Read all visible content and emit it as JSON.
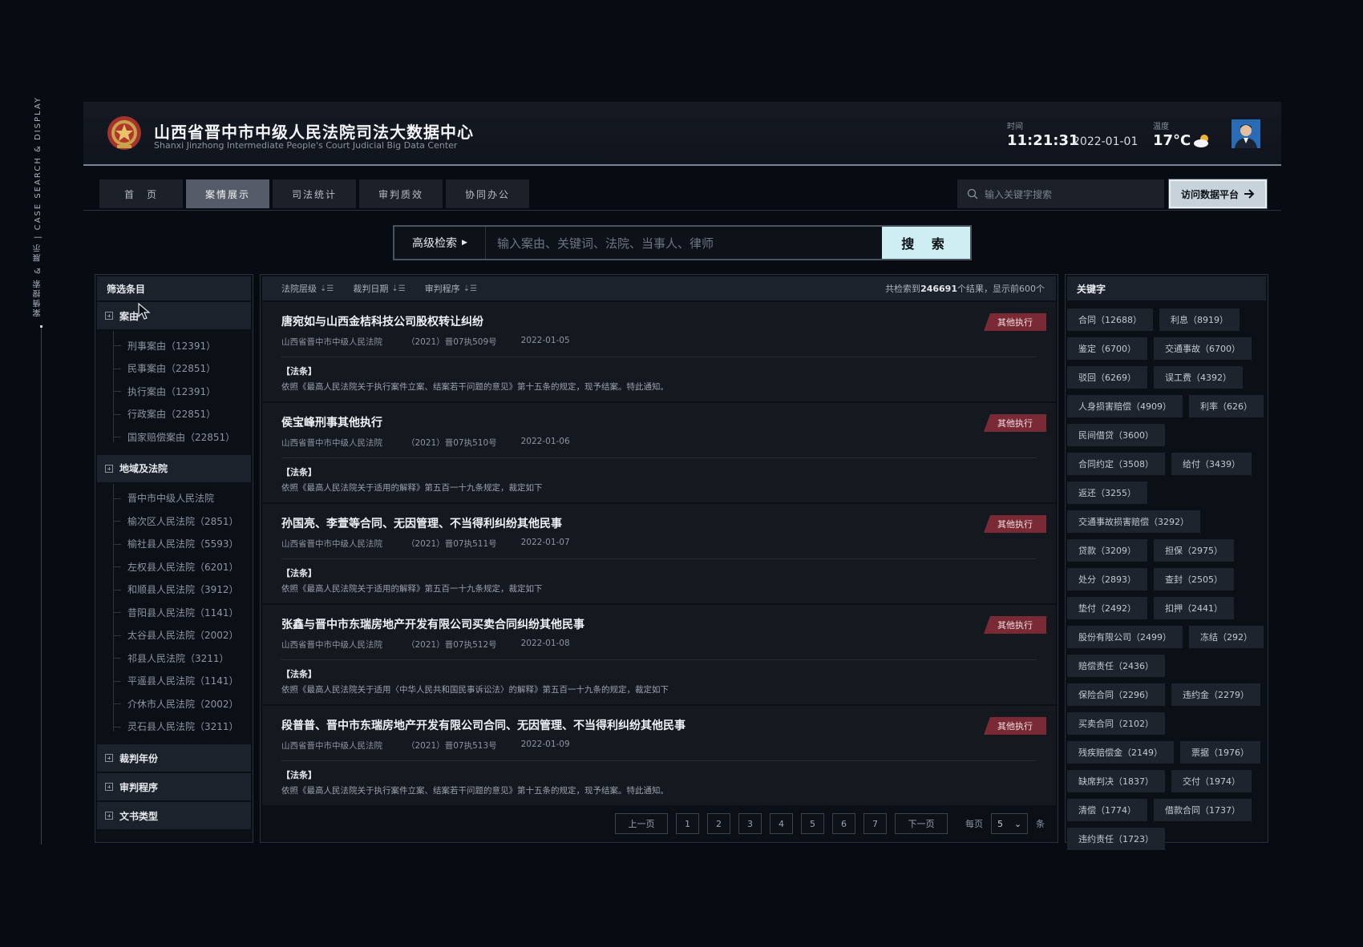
{
  "side_label": "案情搜索 & 展示 | CASE SEARCH & DISPLAY",
  "header": {
    "title_cn": "山西省晋中市中级人民法院司法大数据中心",
    "title_en": "Shanxi Jinzhong Intermediate People's Court Judicial Big Data Center",
    "time_label": "时间",
    "time": "11:21:31",
    "date": "2022-01-01",
    "temp_label": "温度",
    "temp": "17°C",
    "weather_icon": "partly-cloudy-icon"
  },
  "nav": {
    "tabs": [
      "首　页",
      "案情展示",
      "司法统计",
      "审判质效",
      "协同办公"
    ],
    "active_index": 1,
    "search_placeholder": "输入关键字搜索",
    "visit_button": "访问数据平台"
  },
  "main_search": {
    "advanced": "高级检索",
    "placeholder": "输入案由、关键词、法院、当事人、律师",
    "button": "搜 索"
  },
  "filters": {
    "title": "筛选条目",
    "groups": [
      {
        "label": "案由",
        "items": [
          "刑事案由（12391）",
          "民事案由（22851）",
          "执行案由（12391）",
          "行政案由（22851）",
          "国家赔偿案由（22851）"
        ]
      },
      {
        "label": "地域及法院",
        "items": [
          "晋中市中级人民法院",
          "榆次区人民法院（2851）",
          "榆社县人民法院（5593）",
          "左权县人民法院（6201）",
          "和顺县人民法院（3912）",
          "昔阳县人民法院（1141）",
          "太谷县人民法院（2002）",
          "祁县人民法院（3211）",
          "平遥县人民法院（1141）",
          "介休市人民法院（2002）",
          "灵石县人民法院（3211）"
        ]
      },
      {
        "label": "裁判年份",
        "items": []
      },
      {
        "label": "审判程序",
        "items": []
      },
      {
        "label": "文书类型",
        "items": []
      }
    ]
  },
  "list": {
    "sorts": [
      "法院层级",
      "裁判日期",
      "审判程序"
    ],
    "count_prefix": "共检索到",
    "count": "246691",
    "count_suffix": "个结果，显示前600个",
    "cases": [
      {
        "title": "唐宛如与山西金桔科技公司股权转让纠纷",
        "court": "山西省晋中市中级人民法院",
        "case_no": "（2021）晋07执509号",
        "date": "2022-01-05",
        "badge": "其他执行",
        "law_label": "【法条】",
        "law": "依照《最高人民法院关于执行案件立案、结案若干问题的意见》第十五条的规定，现予结案。特此通知。"
      },
      {
        "title": "侯宝峰刑事其他执行",
        "court": "山西省晋中市中级人民法院",
        "case_no": "（2021）晋07执510号",
        "date": "2022-01-06",
        "badge": "其他执行",
        "law_label": "【法条】",
        "law": "依照《最高人民法院关于适用的解释》第五百一十九条规定，裁定如下"
      },
      {
        "title": "孙国亮、李萱等合同、无因管理、不当得利纠纷其他民事",
        "court": "山西省晋中市中级人民法院",
        "case_no": "（2021）晋07执511号",
        "date": "2022-01-07",
        "badge": "其他执行",
        "law_label": "【法条】",
        "law": "依照《最高人民法院关于适用的解释》第五百一十九条规定，裁定如下"
      },
      {
        "title": "张鑫与晋中市东瑞房地产开发有限公司买卖合同纠纷其他民事",
        "court": "山西省晋中市中级人民法院",
        "case_no": "（2021）晋07执512号",
        "date": "2022-01-08",
        "badge": "其他执行",
        "law_label": "【法条】",
        "law": "依照《最高人民法院关于适用〈中华人民共和国民事诉讼法〉的解释》第五百一十九条的规定，裁定如下"
      },
      {
        "title": "段普普、晋中市东瑞房地产开发有限公司合同、无因管理、不当得利纠纷其他民事",
        "court": "山西省晋中市中级人民法院",
        "case_no": "（2021）晋07执513号",
        "date": "2022-01-09",
        "badge": "其他执行",
        "law_label": "【法条】",
        "law": "依照《最高人民法院关于执行案件立案、结案若干问题的意见》第十五条的规定，现予结案。特此通知。"
      }
    ]
  },
  "pager": {
    "prev": "上一页",
    "pages": [
      "1",
      "2",
      "3",
      "4",
      "5",
      "6",
      "7"
    ],
    "next": "下一页",
    "per_page_label": "每页",
    "per_page_value": "5",
    "per_page_unit": "条"
  },
  "keywords": {
    "title": "关键字",
    "items": [
      "合同（12688）",
      "利息（8919）",
      "鉴定（6700）",
      "交通事故（6700）",
      "驳回（6269）",
      "误工费（4392）",
      "人身损害赔偿（4909）",
      "利率（626）",
      "民间借贷（3600）",
      "合同约定（3508）",
      "给付（3439）",
      "返还（3255）",
      "交通事故损害赔偿（3292）",
      "贷款（3209）",
      "担保（2975）",
      "处分（2893）",
      "查封（2505）",
      "垫付（2492）",
      "扣押（2441）",
      "股份有限公司（2499）",
      "冻结（292）",
      "赔偿责任（2436）",
      "保险合同（2296）",
      "违约金（2279）",
      "买卖合同（2102）",
      "残疾赔偿金（2149）",
      "票据（1976）",
      "缺席判决（1837）",
      "交付（1974）",
      "清偿（1774）",
      "借款合同（1737）",
      "违约责任（1723）"
    ]
  },
  "colors": {
    "background": "#070b12",
    "accent": "#cfeef2",
    "badge": "#7a2a35",
    "active_tab": "#555c68"
  }
}
